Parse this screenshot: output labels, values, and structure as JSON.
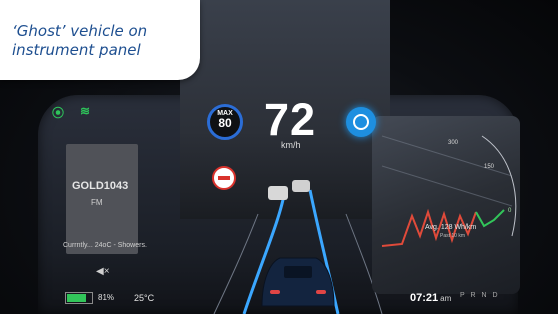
{
  "caption": {
    "text": "‘Ghost’ vehicle on\ninstrument panel"
  },
  "left_panel": {
    "card_title": "GOLD1043",
    "card_sub": "FM",
    "weather": "Currntly... 24oC - Showers.",
    "battery_pct": "81%",
    "battery_level": 0.81,
    "temperature": "25°C"
  },
  "center": {
    "max_label": "MAX",
    "max_value": "80",
    "speed": "72",
    "unit": "km/h"
  },
  "right_panel": {
    "scale_top": "300",
    "scale_mid": "150",
    "scale_zero": "0",
    "avg_text": "Avg. 128 Wh/km",
    "avg_sub": "Past 10 km",
    "time": "07:21",
    "ampm": "am",
    "gears": "P R N D"
  },
  "colors": {
    "caption_text": "#1e4f90",
    "accent_blue": "#1e8fe0",
    "battery_green": "#32c55a",
    "lane_blue": "#3ba7ff"
  }
}
